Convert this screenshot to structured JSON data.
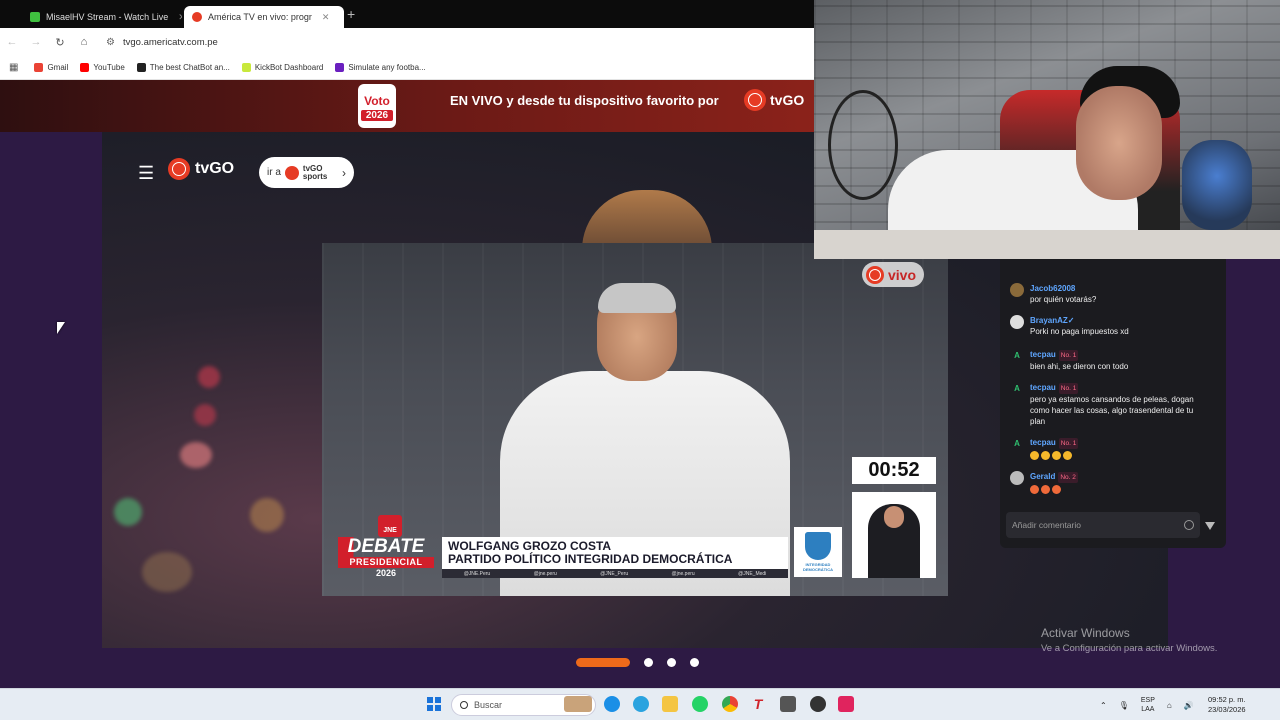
{
  "browser": {
    "tabs": [
      {
        "title": "MisaelHV Stream - Watch Live",
        "color": "#3fbf3f",
        "active": false
      },
      {
        "title": "América TV en vivo: progr",
        "color": "#e63b24",
        "active": true
      }
    ],
    "new_tab": "+",
    "url": "tvgo.americatv.com.pe",
    "bookmarks": [
      {
        "label": "Gmail",
        "color": "#ea4335"
      },
      {
        "label": "YouTube",
        "color": "#ff0000"
      },
      {
        "label": "The best ChatBot an...",
        "color": "#222222"
      },
      {
        "label": "KickBot Dashboard",
        "color": "#c8e83c"
      },
      {
        "label": "Simulate any footba...",
        "color": "#6a1fbf"
      }
    ]
  },
  "site": {
    "voto": {
      "line1": "Voto",
      "line2": "2026"
    },
    "banner_text": "EN VIVO y desde tu dispositivo favorito por",
    "brand": "tvGO",
    "goto_prefix": "ir a",
    "goto_brand": "tvGO",
    "goto_sub": "sports",
    "live_badge": "vivo",
    "timer": "00:52",
    "debate": {
      "jne": "JNE",
      "line1": "DEBATE",
      "line2": "PRESIDENCIAL",
      "line3": "2026"
    },
    "speaker_name": "WOLFGANG GROZO COSTA",
    "speaker_party": "PARTIDO POLÍTICO INTEGRIDAD DEMOCRÁTICA",
    "socials": [
      "@JNE.Peru",
      "@jne.peru",
      "@JNE_Peru",
      "@jne.peru",
      "@JNE_Medi"
    ],
    "party_logo_text": "INTEGRIDAD DEMOCRÁTICA"
  },
  "chat": {
    "messages": [
      {
        "user": "Jacob62008",
        "badge": "",
        "text": "por quién votarás?",
        "avatar": "",
        "avatar_color": "#8a6a3a"
      },
      {
        "user": "BrayanAZ✓",
        "badge": "",
        "text": "Porki no paga impuestos xd",
        "avatar": "",
        "avatar_color": "#dddddd"
      },
      {
        "user": "tecpau",
        "badge": "No. 1",
        "text": "bien ahi, se dieron con todo",
        "avatar": "A",
        "avatar_color": "#1b1b1f"
      },
      {
        "user": "tecpau",
        "badge": "No. 1",
        "text": "pero ya estamos cansandos de peleas, dogan como hacer las cosas, algo trasendental de tu plan",
        "avatar": "A",
        "avatar_color": "#1b1b1f"
      },
      {
        "user": "tecpau",
        "badge": "No. 1",
        "text": "",
        "avatar": "A",
        "avatar_color": "#1b1b1f",
        "emojis": 4
      },
      {
        "user": "Gerald",
        "badge": "No. 2",
        "text": "",
        "avatar": "",
        "avatar_color": "#bbbbbb",
        "emojis": 3
      }
    ],
    "input_placeholder": "Añadir comentario"
  },
  "watermark": {
    "line1": "Activar Windows",
    "line2": "Ve a Configuración para activar Windows."
  },
  "taskbar": {
    "search_label": "Buscar",
    "lang_top": "ESP",
    "lang_bottom": "LAA",
    "time": "09:52 p. m.",
    "date": "23/03/2026"
  }
}
